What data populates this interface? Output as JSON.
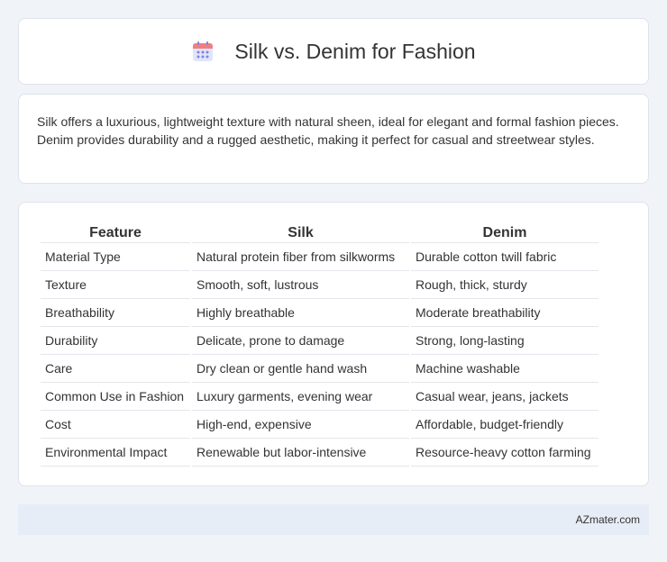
{
  "header": {
    "title": "Silk vs. Denim for Fashion",
    "icon": "calendar-icon"
  },
  "intro": {
    "text": "Silk offers a luxurious, lightweight texture with natural sheen, ideal for elegant and formal fashion pieces. Denim provides durability and a rugged aesthetic, making it perfect for casual and streetwear styles."
  },
  "table": {
    "headers": [
      "Feature",
      "Silk",
      "Denim"
    ],
    "rows": [
      [
        "Material Type",
        "Natural protein fiber from silkworms",
        "Durable cotton twill fabric"
      ],
      [
        "Texture",
        "Smooth, soft, lustrous",
        "Rough, thick, sturdy"
      ],
      [
        "Breathability",
        "Highly breathable",
        "Moderate breathability"
      ],
      [
        "Durability",
        "Delicate, prone to damage",
        "Strong, long-lasting"
      ],
      [
        "Care",
        "Dry clean or gentle hand wash",
        "Machine washable"
      ],
      [
        "Common Use in Fashion",
        "Luxury garments, evening wear",
        "Casual wear, jeans, jackets"
      ],
      [
        "Cost",
        "High-end, expensive",
        "Affordable, budget-friendly"
      ],
      [
        "Environmental Impact",
        "Renewable but labor-intensive",
        "Resource-heavy cotton farming"
      ]
    ]
  },
  "footer": {
    "brand": "AZmater.com"
  },
  "colors": {
    "background": "#f0f3f8",
    "card": "#ffffff",
    "footer_bg": "#e7edf6",
    "icon_top": "#f06b6b",
    "icon_body": "#c9d6f5",
    "icon_dots": "#8a7fe0"
  }
}
